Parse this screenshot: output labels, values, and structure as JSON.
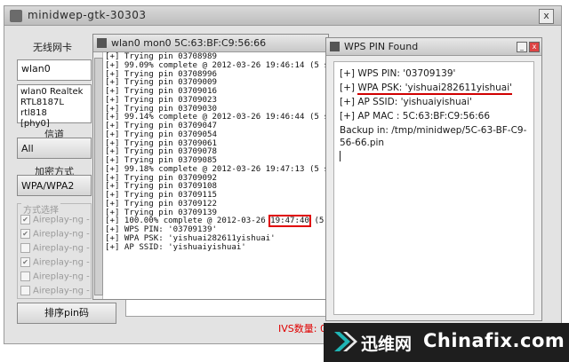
{
  "main_window": {
    "title": "minidwep-gtk-30303",
    "close_glyph": "x"
  },
  "left_panel": {
    "wireless_label": "无线网卡",
    "interface_value": "wlan0",
    "adapter_info": [
      "wlan0 Realtek",
      "RTL8187L rtl818",
      "[phy0]"
    ],
    "channel_label": "信道",
    "channel_value": "All",
    "encryption_label": "加密方式",
    "encryption_value": "WPA/WPA2",
    "method_label": "方式选择",
    "methods": [
      {
        "label": "Aireplay-ng -",
        "checked": true
      },
      {
        "label": "Aireplay-ng -",
        "checked": true
      },
      {
        "label": "Aireplay-ng -",
        "checked": false
      },
      {
        "label": "Aireplay-ng -",
        "checked": true
      },
      {
        "label": "Aireplay-ng -",
        "checked": false
      },
      {
        "label": "Aireplay-ng -",
        "checked": false
      }
    ],
    "sort_pin_button": "排序pin码"
  },
  "terminal": {
    "title": "wlan0 mon0 5C:63:BF:C9:56:66",
    "lines": [
      "[+] Trying pin 03708989",
      "[+] 99.09% complete @ 2012-03-26 19:46:14 (5 seconds",
      "[+] Trying pin 03708996",
      "[+] Trying pin 03709009",
      "[+] Trying pin 03709016",
      "[+] Trying pin 03709023",
      "[+] Trying pin 03709030",
      "[+] 99.14% complete @ 2012-03-26 19:46:44 (5 seconds",
      "[+] Trying pin 03709047",
      "[+] Trying pin 03709054",
      "[+] Trying pin 03709061",
      "[+] Trying pin 03709078",
      "[+] Trying pin 03709085",
      "[+] 99.18% complete @ 2012-03-26 19:47:13 (5 seconds",
      "[+] Trying pin 03709092",
      "[+] Trying pin 03709108",
      "[+] Trying pin 03709115",
      "[+] Trying pin 03709122",
      "[+] Trying pin 03709139"
    ],
    "final_prefix": "[+] 100.00% complete @ 2012-03-26 ",
    "final_time": "19:47:40",
    "final_suffix": " (5 seconds",
    "result_lines": [
      "[+] WPS PIN: '03709139'",
      "[+] WPA PSK: 'yishuai282611yishuai'",
      "[+] AP SSID: 'yishuaiyishuai'"
    ]
  },
  "wps_window": {
    "title": "WPS PIN Found",
    "min_glyph": "_",
    "close_glyph": "x",
    "pin_line": "[+] WPS PIN: '03709139'",
    "psk_prefix": "[+] ",
    "psk_line": "WPA PSK: 'yishuai282611yishuai'",
    "ssid_line": "[+] AP SSID: 'yishuaiyishuai'",
    "mac_line": "[+] AP MAC : 5C:63:BF:C9:56:66",
    "backup_line": "Backup in: /tmp/minidwep/5C-63-BF-C9-56-66.pin"
  },
  "status": {
    "ivs_label": "IVS数量: 0"
  },
  "watermark": {
    "cn": "迅维网",
    "en": "Chinafix.com"
  },
  "colors": {
    "highlight": "#e00000",
    "watermark_bg": "#1e1e1e",
    "logo_teal": "#1fb5b5"
  }
}
